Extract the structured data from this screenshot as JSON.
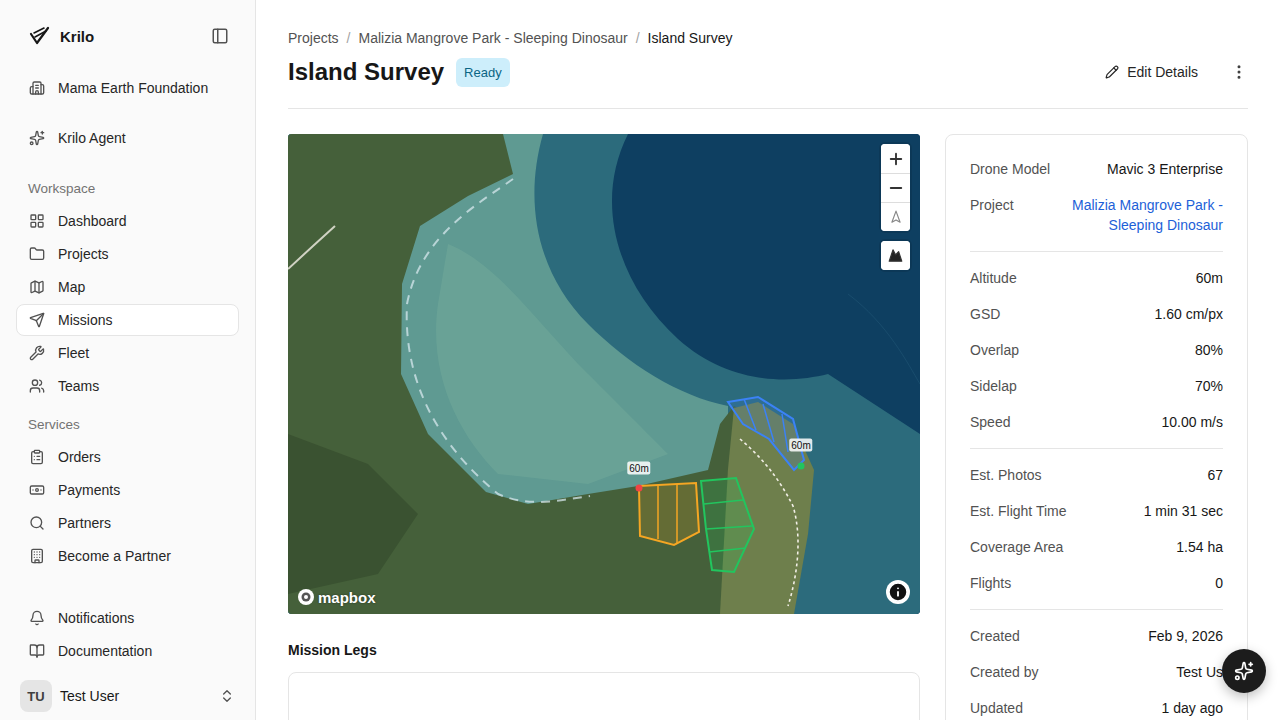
{
  "sidebar": {
    "brand": "Krilo",
    "org": "Mama Earth Foundation",
    "agent": "Krilo Agent",
    "sections": [
      {
        "title": "Workspace",
        "items": [
          {
            "label": "Dashboard",
            "selected": false
          },
          {
            "label": "Projects",
            "selected": false
          },
          {
            "label": "Map",
            "selected": false
          },
          {
            "label": "Missions",
            "selected": true
          },
          {
            "label": "Fleet",
            "selected": false
          },
          {
            "label": "Teams",
            "selected": false
          }
        ]
      },
      {
        "title": "Services",
        "items": [
          {
            "label": "Orders",
            "selected": false
          },
          {
            "label": "Payments",
            "selected": false
          },
          {
            "label": "Partners",
            "selected": false
          },
          {
            "label": "Become a Partner",
            "selected": false
          }
        ]
      }
    ],
    "footer_items": [
      "Notifications",
      "Documentation"
    ],
    "user": {
      "initials": "TU",
      "name": "Test User"
    }
  },
  "breadcrumb": {
    "separator": "/",
    "items": [
      "Projects",
      "Malizia Mangrove Park - Sleeping Dinosaur",
      "Island Survey"
    ]
  },
  "title": "Island Survey",
  "status": "Ready",
  "edit_button": "Edit Details",
  "map": {
    "attribution": "mapbox",
    "legs": [
      {
        "color": "#f5a623",
        "label": "60m"
      },
      {
        "color": "#22c55e",
        "label": ""
      },
      {
        "color": "#3b82f6",
        "label": "60m"
      }
    ]
  },
  "mission_legs_heading": "Mission Legs",
  "details": {
    "groups": [
      [
        {
          "label": "Drone Model",
          "value": "Mavic 3 Enterprise",
          "kind": "text"
        },
        {
          "label": "Project",
          "value": "Malizia Mangrove Park - Sleeping Dinosaur",
          "kind": "link"
        }
      ],
      [
        {
          "label": "Altitude",
          "value": "60m",
          "kind": "text"
        },
        {
          "label": "GSD",
          "value": "1.60 cm/px",
          "kind": "text"
        },
        {
          "label": "Overlap",
          "value": "80%",
          "kind": "text"
        },
        {
          "label": "Sidelap",
          "value": "70%",
          "kind": "text"
        },
        {
          "label": "Speed",
          "value": "10.00 m/s",
          "kind": "text"
        }
      ],
      [
        {
          "label": "Est. Photos",
          "value": "67",
          "kind": "text"
        },
        {
          "label": "Est. Flight Time",
          "value": "1 min 31 sec",
          "kind": "text"
        },
        {
          "label": "Coverage Area",
          "value": "1.54 ha",
          "kind": "text"
        },
        {
          "label": "Flights",
          "value": "0",
          "kind": "text"
        }
      ],
      [
        {
          "label": "Created",
          "value": "Feb 9, 2026",
          "kind": "text"
        },
        {
          "label": "Created by",
          "value": "Test Us",
          "kind": "text"
        },
        {
          "label": "Updated",
          "value": "1 day ago",
          "kind": "text"
        }
      ]
    ]
  }
}
